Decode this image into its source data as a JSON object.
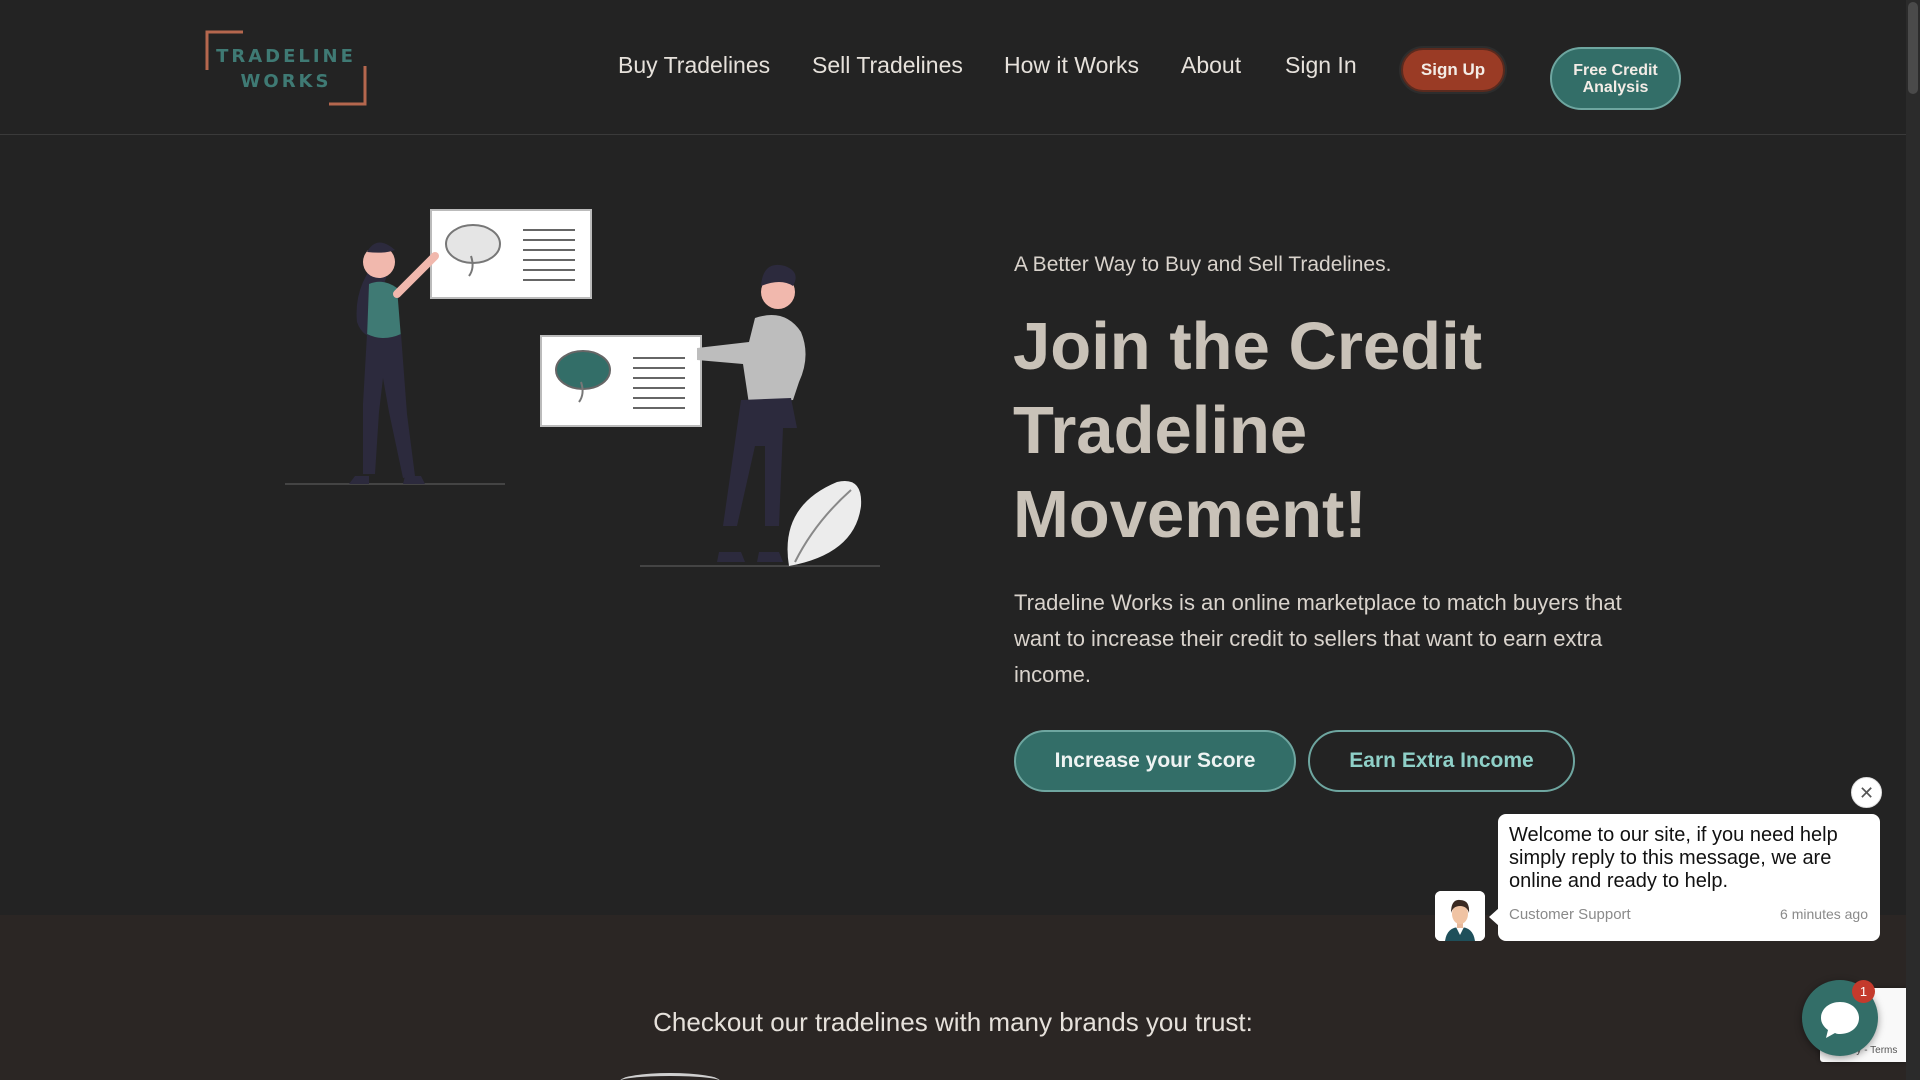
{
  "brand": {
    "logo_line1": "TRADELINE",
    "logo_line2": "WORKS",
    "logo_text_color": "#3f7a74",
    "logo_frame_color": "#b5674e"
  },
  "nav": {
    "items": [
      {
        "label": "Buy Tradelines"
      },
      {
        "label": "Sell Tradelines"
      },
      {
        "label": "How it Works"
      },
      {
        "label": "About"
      },
      {
        "label": "Sign In"
      }
    ],
    "signup_label": "Sign Up",
    "analysis_label": "Free Credit Analysis"
  },
  "hero": {
    "kicker": "A Better Way to Buy and Sell Tradelines.",
    "title": "Join the Credit Tradeline Movement!",
    "description": "Tradeline Works is an online marketplace to match buyers that want to increase their credit to sellers that want to earn extra income.",
    "primary_cta": "Increase your Score",
    "secondary_cta": "Earn Extra Income",
    "illustration": "people-presenting-charts-illustration"
  },
  "brands": {
    "title": "Checkout our tradelines with many brands you trust:"
  },
  "chat": {
    "message": "Welcome to our site, if you need help simply reply to this message, we are online and ready to help.",
    "agent": "Customer Support",
    "time": "6 minutes ago",
    "unread_count": "1",
    "close_icon": "close-icon",
    "launcher_icon": "chat-bubble-icon"
  },
  "recaptcha": {
    "text": "Privacy - Terms"
  },
  "colors": {
    "background": "#232323",
    "accent_teal": "#336e68",
    "accent_rust": "#9a3b25",
    "brands_band": "#2b2624",
    "title_text": "#c9c2b8"
  }
}
